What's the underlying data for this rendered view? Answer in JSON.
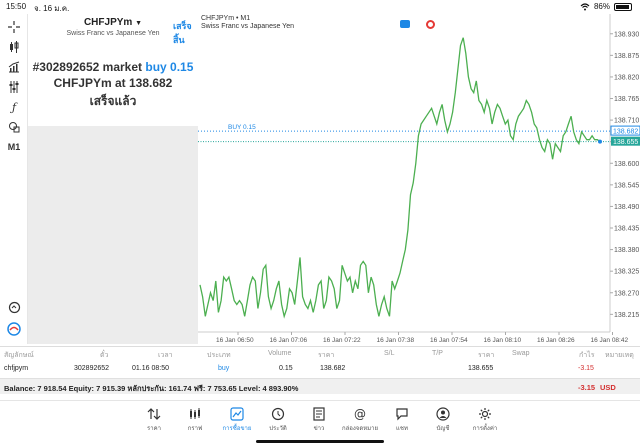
{
  "status": {
    "time": "15:50",
    "date": "จ. 16 ม.ค.",
    "wifi_icon": "wifi-icon",
    "battery": "86%"
  },
  "toolbar": {
    "items": [
      {
        "icon": "crosshair-icon"
      },
      {
        "icon": "candles-icon"
      },
      {
        "icon": "indicators-icon"
      },
      {
        "icon": "settings-sliders-icon"
      },
      {
        "icon": "function-icon"
      },
      {
        "icon": "objects-icon"
      },
      {
        "label": "M1"
      },
      {
        "icon": "zoom-icon"
      },
      {
        "icon": "mt-logo-icon"
      }
    ]
  },
  "trade_panel": {
    "symbol": "CHFJPYm",
    "done_label": "เสร็จสิ้น",
    "description": "Swiss Franc vs Japanese Yen",
    "order_prefix": "#302892652 market ",
    "order_side": "buy 0.15",
    "line2": "CHFJPYm at 138.682",
    "line3": "เสร็จแล้ว"
  },
  "chart": {
    "title": "CHFJPYm • M1",
    "subtitle": "Swiss Franc vs Japanese Yen",
    "buy_label": "BUY 0.15",
    "buy_price": "138.682",
    "current_price": "138.655",
    "colors": {
      "line": "#4caf50",
      "buy": "#1e88e5",
      "bid": "#26a69a",
      "grid": "#f0f0f0"
    }
  },
  "chart_data": {
    "type": "line",
    "title": "CHFJPYm • M1",
    "ylim": [
      138.17,
      138.96
    ],
    "ytick_labels": [
      "138.930",
      "138.875",
      "138.820",
      "138.765",
      "138.710",
      "138.655",
      "138.600",
      "138.545",
      "138.490",
      "138.435",
      "138.380",
      "138.325",
      "138.270",
      "138.215"
    ],
    "xtick_labels": [
      "16 Jan 06:50",
      "16 Jan 07:06",
      "16 Jan 07:22",
      "16 Jan 07:38",
      "16 Jan 07:54",
      "16 Jan 08:10",
      "16 Jan 08:26",
      "16 Jan 08:42"
    ],
    "series": [
      {
        "values": [
          138.29,
          138.26,
          138.21,
          138.24,
          138.27,
          138.25,
          138.3,
          138.22,
          138.25,
          138.31,
          138.3,
          138.31,
          138.28,
          138.25,
          138.24,
          138.25,
          138.24,
          138.21,
          138.25,
          138.29,
          138.31,
          138.3,
          138.23,
          138.27,
          138.33,
          138.34,
          138.26,
          138.23,
          138.25,
          138.28,
          138.3,
          138.24,
          138.21,
          138.23,
          138.28,
          138.27,
          138.24,
          138.3,
          138.36,
          138.26,
          138.24,
          138.23,
          138.25,
          138.22,
          138.25,
          138.29,
          138.3,
          138.23,
          138.25,
          138.31,
          138.3,
          138.28,
          138.23,
          138.25,
          138.34,
          138.32,
          138.3,
          138.31,
          138.27,
          138.3,
          138.28,
          138.34,
          138.35,
          138.34,
          138.27,
          138.31,
          138.29,
          138.24,
          138.21,
          138.24,
          138.26,
          138.23,
          138.21,
          138.3,
          138.28,
          138.3,
          138.32,
          138.35,
          138.38,
          138.43,
          138.52,
          138.55,
          138.6,
          138.67,
          138.7,
          138.71,
          138.72,
          138.73,
          138.74,
          138.72,
          138.7,
          138.73,
          138.75,
          138.71,
          138.68,
          138.7,
          138.73,
          138.78,
          138.84,
          138.9,
          138.92,
          138.88,
          138.82,
          138.79,
          138.78,
          138.81,
          138.76,
          138.75,
          138.73,
          138.76,
          138.74,
          138.7,
          138.73,
          138.75,
          138.74,
          138.72,
          138.7,
          138.71,
          138.67,
          138.66,
          138.7,
          138.72,
          138.73,
          138.74,
          138.76,
          138.75,
          138.73,
          138.7,
          138.69,
          138.66,
          138.64,
          138.63,
          138.66,
          138.65,
          138.61,
          138.65,
          138.64,
          138.63,
          138.67,
          138.68,
          138.7,
          138.72,
          138.68,
          138.66,
          138.65,
          138.68,
          138.67,
          138.66,
          138.66,
          138.67,
          138.66,
          138.66,
          138.655
        ]
      }
    ],
    "buy_line": 138.682,
    "bid_line": 138.655,
    "grid": true
  },
  "table": {
    "headers": [
      "สัญลักษณ์",
      "ตั๋ว",
      "เวลา",
      "ประเภท",
      "Volume",
      "ราคา",
      "S/L",
      "T/P",
      "ราคา",
      "Swap",
      "กำไร",
      "หมายเหตุ"
    ],
    "row": {
      "symbol": "chfjpym",
      "ticket": "302892652",
      "time": "01.16 08:50",
      "type": "buy",
      "volume": "0.15",
      "open_price": "138.682",
      "price": "138.655",
      "profit": "-3.15"
    }
  },
  "balance": {
    "text": "Balance: 7 918.54 Equity: 7 915.39 หลักประกัน: 161.74 ฟรี: 7 753.65 Level: 4 893.90%",
    "profit": "-3.15",
    "currency": "USD"
  },
  "tabs": [
    {
      "label": "ราคา",
      "icon": "quotes-icon"
    },
    {
      "label": "กราฟ",
      "icon": "chart-icon"
    },
    {
      "label": "การซื้อขาย",
      "icon": "trade-icon",
      "active": true
    },
    {
      "label": "ประวัติ",
      "icon": "history-icon"
    },
    {
      "label": "ข่าว",
      "icon": "news-icon"
    },
    {
      "label": "กล่องจดหมาย",
      "icon": "mailbox-icon"
    },
    {
      "label": "แชท",
      "icon": "chat-icon"
    },
    {
      "label": "บัญชี",
      "icon": "account-icon"
    },
    {
      "label": "การตั้งค่า",
      "icon": "settings-icon"
    }
  ]
}
